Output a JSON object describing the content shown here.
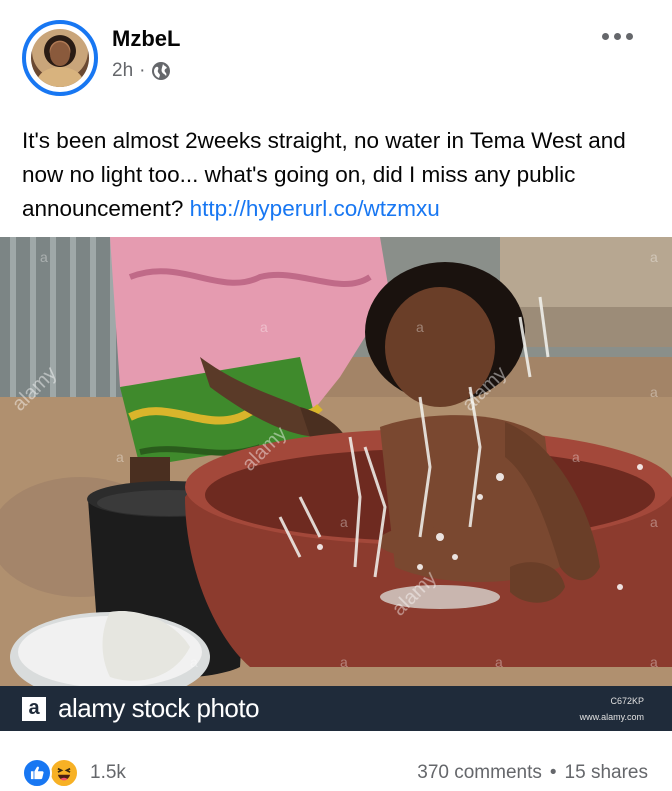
{
  "post": {
    "author": "MzbeL",
    "time": "2h",
    "separator": "·",
    "audience_icon": "globe-icon",
    "body": "It's been almost 2weeks straight, no water in Tema West and now no light too... what's going on, did I miss any public announcement? ",
    "link": "http://hyperurl.co/wtzmxu"
  },
  "image": {
    "watermark_glyph": "a",
    "watermark_word": "alamy",
    "banner": {
      "logo": "a",
      "text": "alamy stock photo",
      "code": "C672KP",
      "url": "www.alamy.com"
    }
  },
  "footer": {
    "reactions": [
      "like-icon",
      "haha-icon"
    ],
    "reaction_count": "1.5k",
    "comments": "370 comments",
    "dot": "•",
    "shares": "15 shares"
  },
  "colors": {
    "accent": "#1877f2",
    "text_secondary": "#65676b",
    "banner_bg": "#1f2b3a"
  }
}
